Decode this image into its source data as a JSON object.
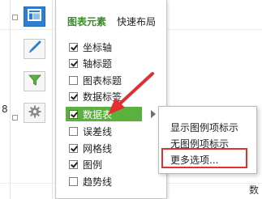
{
  "tabs": {
    "chart_elements": "图表元素",
    "quick_layout": "快速布局"
  },
  "elements": [
    {
      "label": "坐标轴",
      "checked": true
    },
    {
      "label": "轴标题",
      "checked": true
    },
    {
      "label": "图表标题",
      "checked": false
    },
    {
      "label": "数据标签",
      "checked": true
    },
    {
      "label": "数据表",
      "checked": true
    },
    {
      "label": "误差线",
      "checked": false
    },
    {
      "label": "网格线",
      "checked": true
    },
    {
      "label": "图例",
      "checked": true
    },
    {
      "label": "趋势线",
      "checked": false
    }
  ],
  "submenu": {
    "items": [
      "显示图例项标示",
      "无图例项标示",
      "更多选项..."
    ]
  },
  "background": {
    "left_fragment": "8",
    "bottom_fragment": "数"
  },
  "colors": {
    "active_tab": "#3a8a2a",
    "highlight_row": "#5bb13d",
    "annotation_red": "#e23030",
    "active_icon_bg": "#2f7fd0"
  },
  "icons": [
    "chart-elements-icon",
    "chart-style-brush-icon",
    "chart-filter-icon",
    "settings-gear-icon"
  ]
}
